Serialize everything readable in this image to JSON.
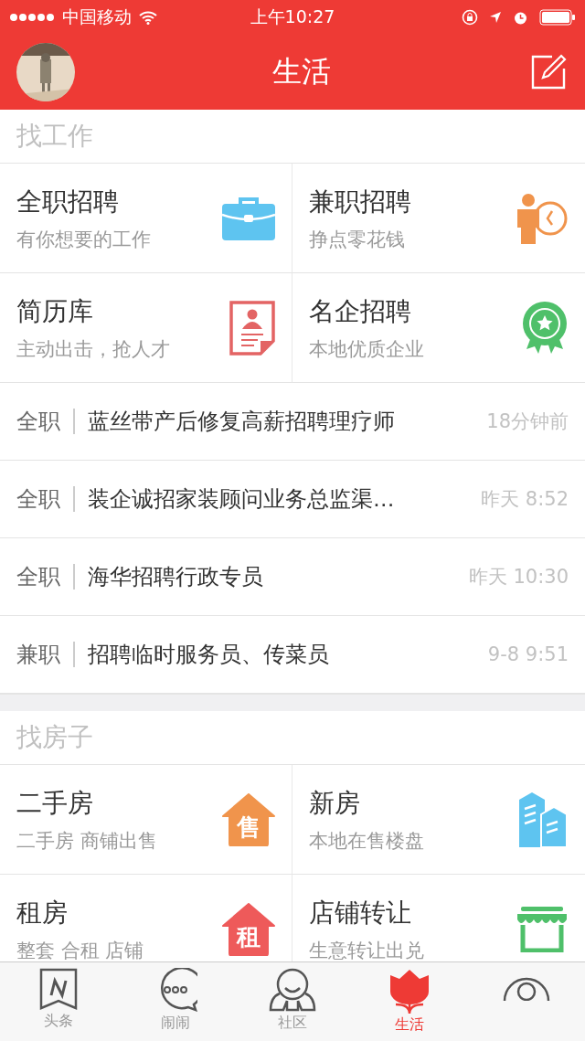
{
  "status_bar": {
    "carrier": "中国移动",
    "time": "上午10:27"
  },
  "nav": {
    "title": "生活"
  },
  "sections": [
    {
      "title": "找工作",
      "tiles": [
        {
          "title": "全职招聘",
          "subtitle": "有你想要的工作",
          "kind": "briefcase"
        },
        {
          "title": "兼职招聘",
          "subtitle": "挣点零花钱",
          "kind": "parttime"
        },
        {
          "title": "简历库",
          "subtitle": "主动出击，抢人才",
          "kind": "resume"
        },
        {
          "title": "名企招聘",
          "subtitle": "本地优质企业",
          "kind": "award"
        }
      ],
      "posts": [
        {
          "type": "全职",
          "title": "蓝丝带产后修复高薪招聘理疗师",
          "time": "18分钟前"
        },
        {
          "type": "全职",
          "title": "装企诚招家装顾问业务总监渠…",
          "time": "昨天  8:52"
        },
        {
          "type": "全职",
          "title": "海华招聘行政专员",
          "time": "昨天 10:30"
        },
        {
          "type": "兼职",
          "title": "招聘临时服务员、传菜员",
          "time": "9-8  9:51"
        }
      ]
    },
    {
      "title": "找房子",
      "tiles": [
        {
          "title": "二手房",
          "subtitle": "二手房 商铺出售",
          "kind": "house",
          "badge": "售",
          "color": "#f0944c"
        },
        {
          "title": "新房",
          "subtitle": "本地在售楼盘",
          "kind": "buildings"
        },
        {
          "title": "租房",
          "subtitle": "整套 合租 店铺",
          "kind": "house",
          "badge": "租",
          "color": "#ee5a5a"
        },
        {
          "title": "店铺转让",
          "subtitle": "生意转让出兑",
          "kind": "shop"
        }
      ]
    }
  ],
  "tab_bar": [
    {
      "label": "头条",
      "kind": "news",
      "selected": false
    },
    {
      "label": "闹闹",
      "kind": "chat",
      "selected": false
    },
    {
      "label": "社区",
      "kind": "community",
      "selected": false
    },
    {
      "label": "生活",
      "kind": "life",
      "selected": true
    },
    {
      "kind": "profile",
      "selected": false
    }
  ]
}
